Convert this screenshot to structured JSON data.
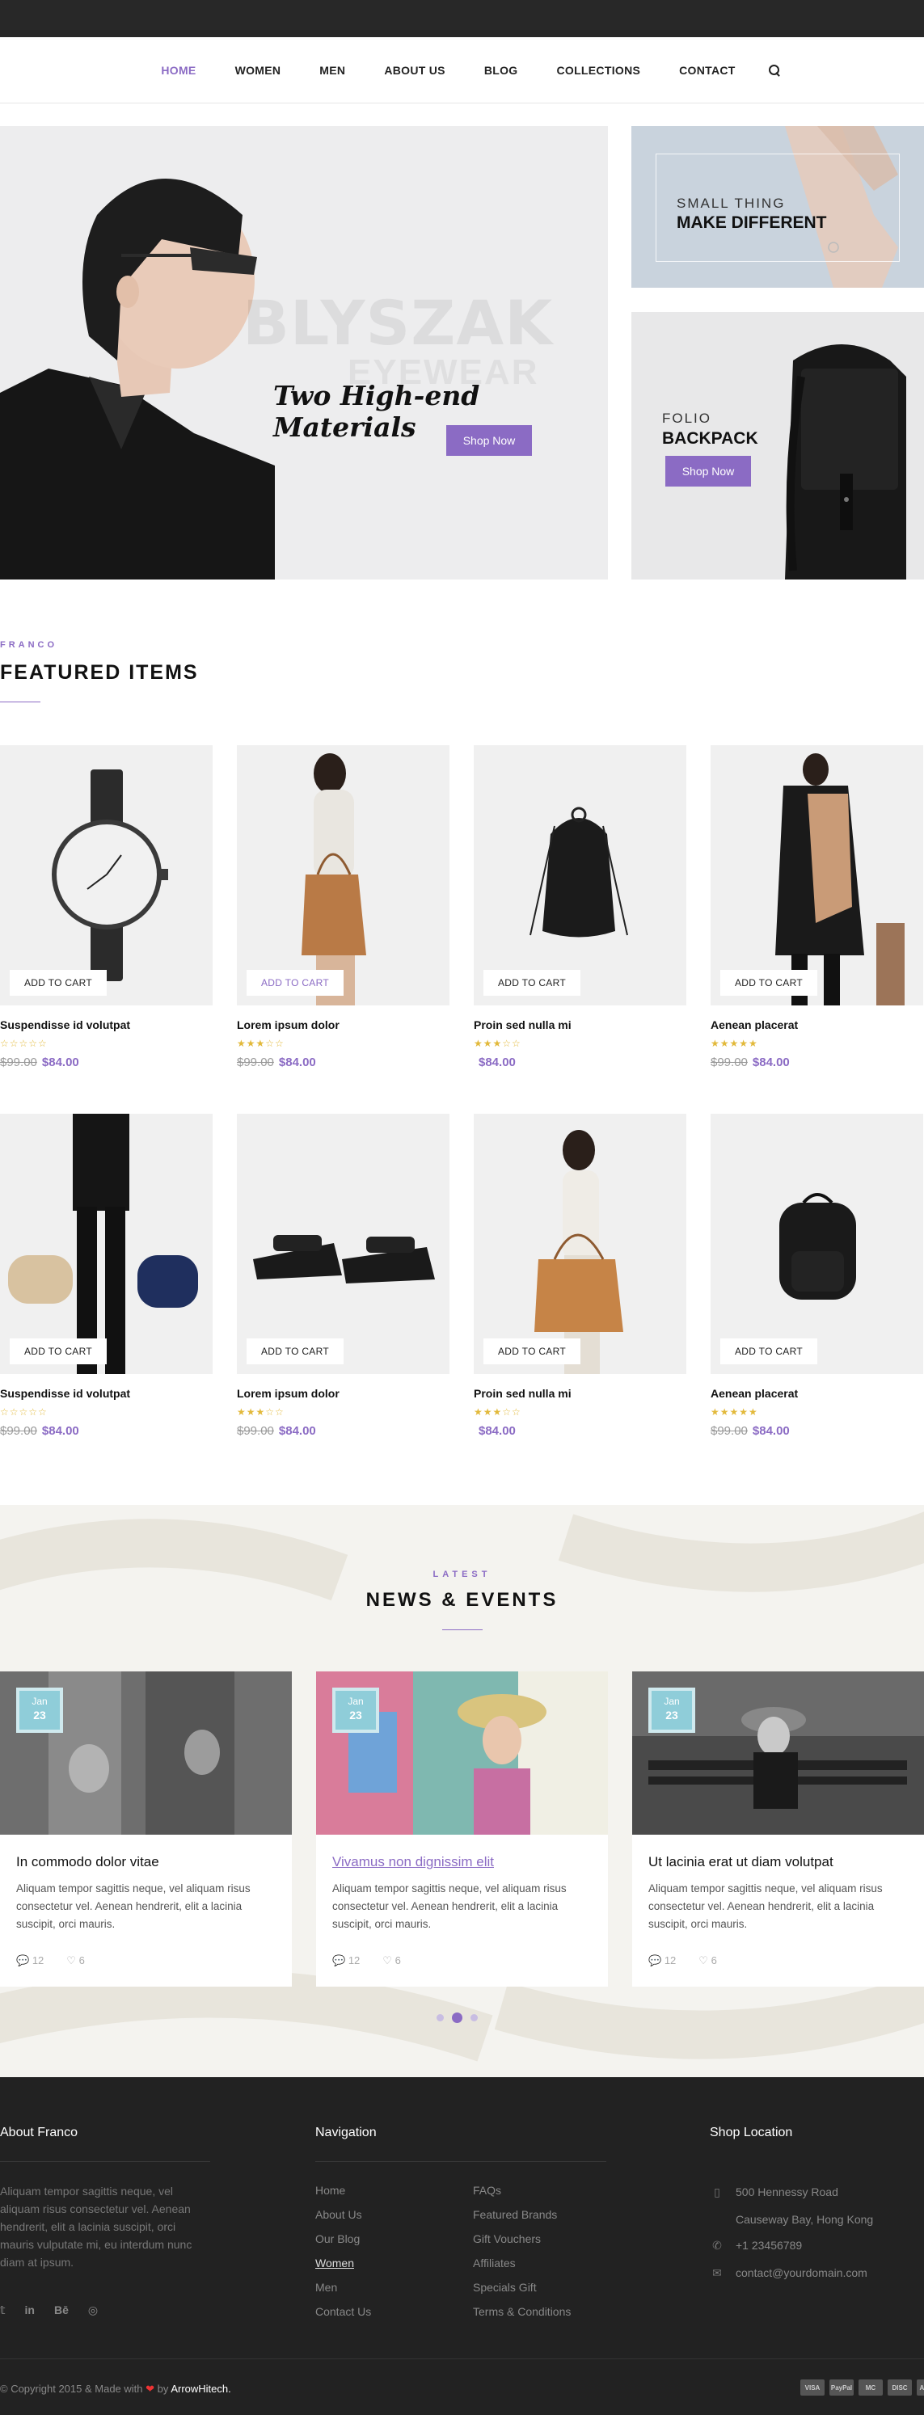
{
  "nav": {
    "items": [
      "HOME",
      "WOMEN",
      "MEN",
      "ABOUT US",
      "BLOG",
      "COLLECTIONS",
      "CONTACT"
    ],
    "active": "HOME"
  },
  "hero": {
    "brand_line1": "BLYSZAK",
    "brand_line2": "EYEWEAR",
    "script": "Two High-end Materials",
    "button": "Shop Now"
  },
  "promo1": {
    "small": "SMALL THING",
    "big": "MAKE DIFFERENT"
  },
  "promo2": {
    "small": "FOLIO",
    "big": "BACKPACK",
    "button": "Shop Now"
  },
  "featured": {
    "label": "FRANCO",
    "title": "FEATURED ITEMS",
    "add_to_cart": "ADD TO CART",
    "products": [
      {
        "name": "Suspendisse id volutpat",
        "old": "$99.00",
        "price": "$84.00",
        "stars": "☆☆☆☆☆"
      },
      {
        "name": "Lorem ipsum dolor",
        "old": "$99.00",
        "price": "$84.00",
        "stars": "★★★☆☆"
      },
      {
        "name": "Proin sed nulla mi",
        "old": "",
        "price": "$84.00",
        "stars": "★★★☆☆"
      },
      {
        "name": "Aenean placerat",
        "old": "$99.00",
        "price": "$84.00",
        "stars": "★★★★★"
      },
      {
        "name": "Suspendisse id volutpat",
        "old": "$99.00",
        "price": "$84.00",
        "stars": "☆☆☆☆☆"
      },
      {
        "name": "Lorem ipsum dolor",
        "old": "$99.00",
        "price": "$84.00",
        "stars": "★★★☆☆"
      },
      {
        "name": "Proin sed nulla mi",
        "old": "",
        "price": "$84.00",
        "stars": "★★★☆☆"
      },
      {
        "name": "Aenean placerat",
        "old": "$99.00",
        "price": "$84.00",
        "stars": "★★★★★"
      }
    ]
  },
  "news": {
    "label": "LATEST",
    "title": "NEWS & EVENTS",
    "posts": [
      {
        "month": "Jan",
        "day": "23",
        "title": "In commodo dolor vitae",
        "text": "Aliquam tempor sagittis neque, vel aliquam risus consectetur vel. Aenean hendrerit, elit a lacinia suscipit, orci mauris.",
        "comments": "12",
        "likes": "6"
      },
      {
        "month": "Jan",
        "day": "23",
        "title": "Vivamus non dignissim elit",
        "text": "Aliquam tempor sagittis neque, vel aliquam risus consectetur vel. Aenean hendrerit, elit a lacinia suscipit, orci mauris.",
        "comments": "12",
        "likes": "6"
      },
      {
        "month": "Jan",
        "day": "23",
        "title": "Ut lacinia erat ut diam volutpat",
        "text": "Aliquam tempor sagittis neque, vel aliquam risus consectetur vel. Aenean hendrerit, elit a lacinia suscipit, orci mauris.",
        "comments": "12",
        "likes": "6"
      }
    ]
  },
  "footer": {
    "about_title": "About Franco",
    "about_text": "Aliquam tempor sagittis neque, vel aliquam risus consectetur vel. Aenean hendrerit, elit a lacinia suscipit, orci mauris vulputate mi, eu interdum nunc diam at ipsum.",
    "nav_title": "Navigation",
    "nav_col1": [
      "Home",
      "About Us",
      "Our Blog",
      "Women",
      "Men",
      "Contact Us"
    ],
    "nav_col2": [
      "FAQs",
      "Featured Brands",
      "Gift Vouchers",
      "Affiliates",
      "Specials Gift",
      "Terms & Conditions"
    ],
    "shop_title": "Shop Location",
    "address1": "500 Hennessy Road",
    "address2": "Causeway Bay, Hong Kong",
    "phone": "+1 23456789",
    "email": "contact@yourdomain.com",
    "copy_prefix": "© Copyright 2015 & Made with",
    "copy_by": "by",
    "copy_brand": "ArrowHitech.",
    "payments": [
      "VISA",
      "PayPal",
      "MC",
      "DISC",
      "AMEX"
    ]
  }
}
